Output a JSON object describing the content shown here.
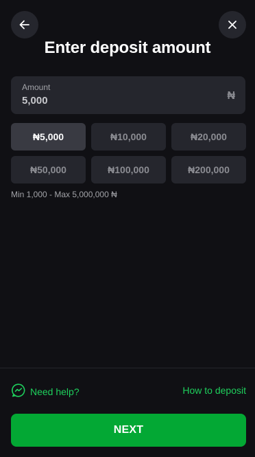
{
  "header": {
    "title": "Enter deposit amount",
    "back_icon": "arrow-left-icon",
    "close_icon": "close-icon"
  },
  "amount_field": {
    "label": "Amount",
    "value": "5,000",
    "currency": "₦"
  },
  "quick_amounts": [
    {
      "label": "₦5,000",
      "selected": true
    },
    {
      "label": "₦10,000",
      "selected": false
    },
    {
      "label": "₦20,000",
      "selected": false
    },
    {
      "label": "₦50,000",
      "selected": false
    },
    {
      "label": "₦100,000",
      "selected": false
    },
    {
      "label": "₦200,000",
      "selected": false
    }
  ],
  "limits_text": "Min 1,000 - Max 5,000,000 ₦",
  "footer": {
    "help_label": "Need help?",
    "help_icon": "chat-bubble-icon",
    "how_to_label": "How to deposit",
    "next_label": "NEXT"
  },
  "colors": {
    "background": "#101014",
    "surface": "#25262d",
    "selected_chip": "#393a42",
    "accent_green": "#1ecf5c",
    "button_green": "#03a834"
  }
}
